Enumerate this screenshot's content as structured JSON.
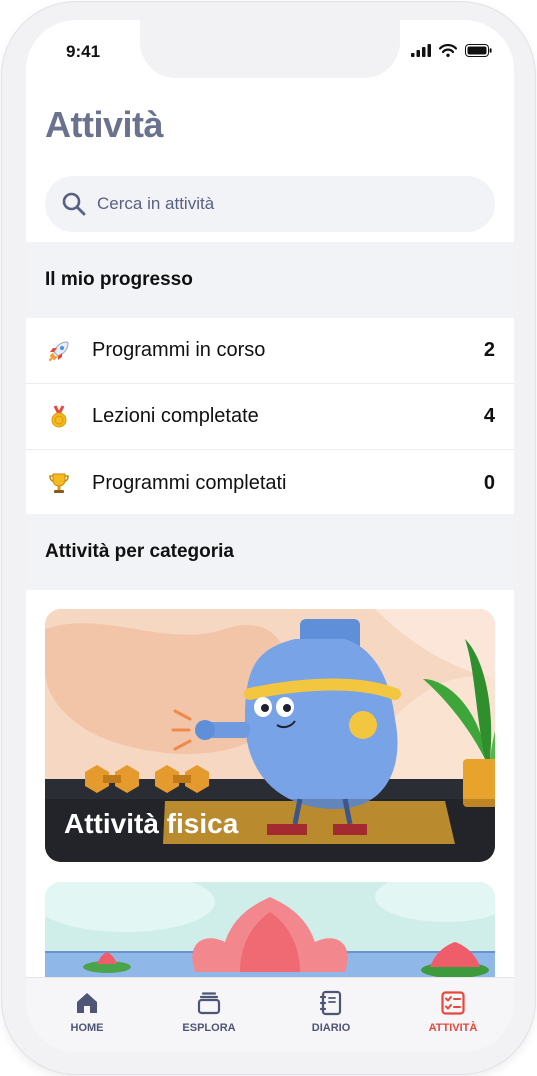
{
  "status": {
    "time": "9:41"
  },
  "page": {
    "title": "Attività"
  },
  "search": {
    "placeholder": "Cerca in attività"
  },
  "progress": {
    "heading": "Il mio progresso",
    "items": [
      {
        "label": "Programmi in corso",
        "count": "2",
        "icon": "rocket-icon"
      },
      {
        "label": "Lezioni completate",
        "count": "4",
        "icon": "medal-icon"
      },
      {
        "label": "Programmi completati",
        "count": "0",
        "icon": "trophy-icon"
      }
    ]
  },
  "categories": {
    "heading": "Attività per categoria",
    "cards": [
      {
        "title": "Attività fisica"
      }
    ]
  },
  "tabbar": {
    "items": [
      {
        "label": "HOME",
        "icon": "home-icon"
      },
      {
        "label": "ESPLORA",
        "icon": "stack-icon"
      },
      {
        "label": "DIARIO",
        "icon": "notebook-icon"
      },
      {
        "label": "ATTIVITÀ",
        "icon": "checklist-icon",
        "active": true
      }
    ]
  },
  "colors": {
    "accent": "#e8473b",
    "title": "#6b728f",
    "section_bg": "#f2f3f7"
  }
}
